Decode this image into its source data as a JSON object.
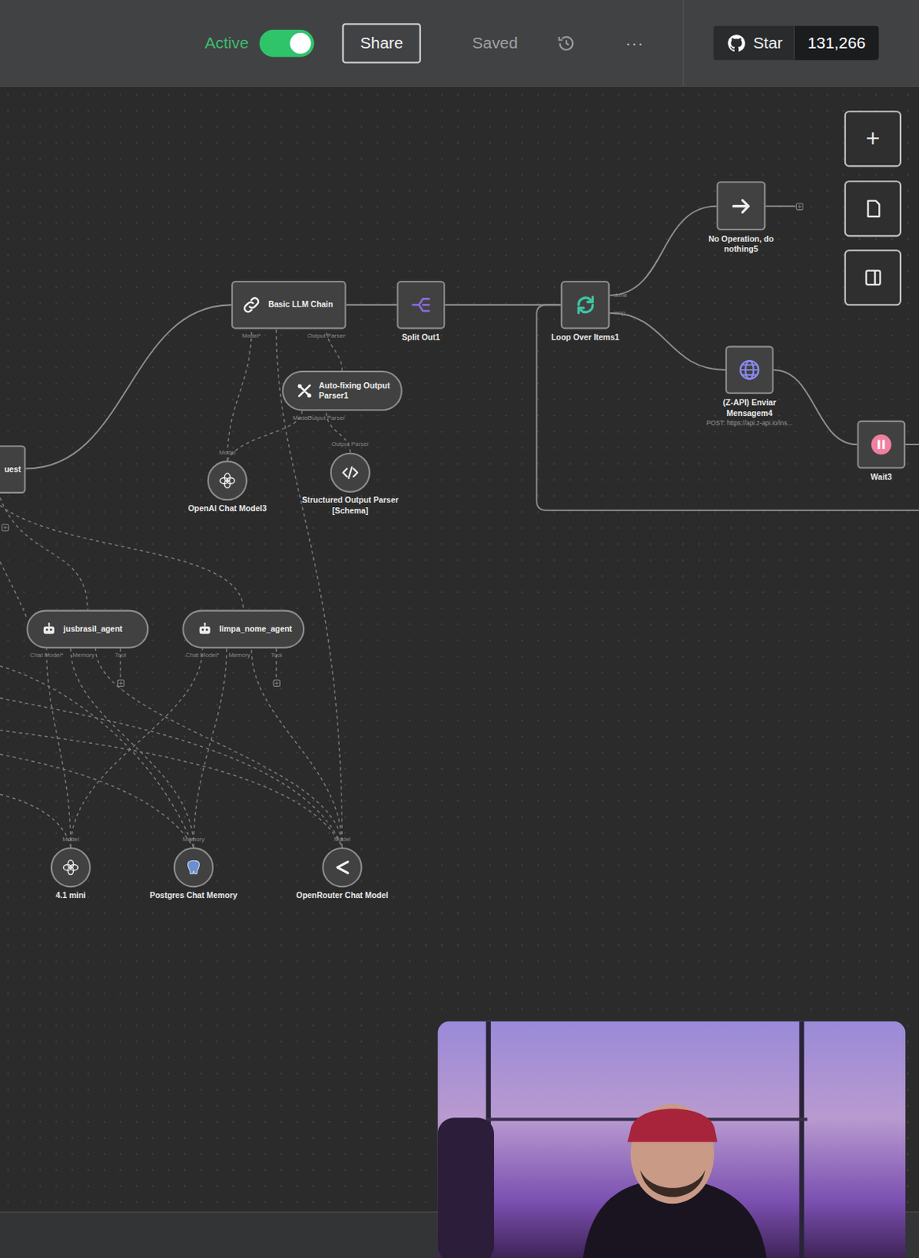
{
  "toolbar": {
    "status_label": "Active",
    "active": true,
    "share": "Share",
    "saved": "Saved",
    "more": "···"
  },
  "github": {
    "star": "Star",
    "count": "131,266"
  },
  "canvas_controls": {
    "zoom_in": "+"
  },
  "nodes": [
    {
      "label": "uest",
      "kind": "wide"
    },
    {
      "label": "Basic LLM Chain",
      "kind": "wide",
      "ports": [
        "Model*",
        "Output Parser"
      ]
    },
    {
      "label": "Split Out1",
      "kind": "main"
    },
    {
      "label": "Loop Over Items1",
      "kind": "main",
      "ports": [
        "done",
        "loop"
      ]
    },
    {
      "label": "No Operation, do nothing5",
      "kind": "main"
    },
    {
      "label": "(Z-API) Enviar Mensagem4",
      "kind": "main",
      "subtitle": "POST: https://api.z-api.io/ins..."
    },
    {
      "label": "Wait3",
      "kind": "main"
    },
    {
      "label": "Auto-fixing Output Parser1",
      "kind": "pill",
      "ports": [
        "Model*",
        "Output Parser"
      ]
    },
    {
      "label": "OpenAI Chat Model3",
      "kind": "sub",
      "top_label": "Model"
    },
    {
      "label": "Structured Output Parser [Schema]",
      "kind": "sub",
      "top_label": "Output Parser"
    },
    {
      "label": "jusbrasil_agent",
      "kind": "pill",
      "ports": [
        "Chat Model*",
        "Memory",
        "Tool"
      ]
    },
    {
      "label": "limpa_nome_agent",
      "kind": "pill",
      "ports": [
        "Chat Model*",
        "Memory",
        "Tool"
      ]
    },
    {
      "label": "4.1 mini",
      "kind": "sub",
      "top_label": "Model"
    },
    {
      "label": "Postgres Chat Memory",
      "kind": "sub",
      "top_label": "Memory"
    },
    {
      "label": "OpenRouter Chat Model",
      "kind": "sub",
      "top_label": "Model"
    }
  ]
}
